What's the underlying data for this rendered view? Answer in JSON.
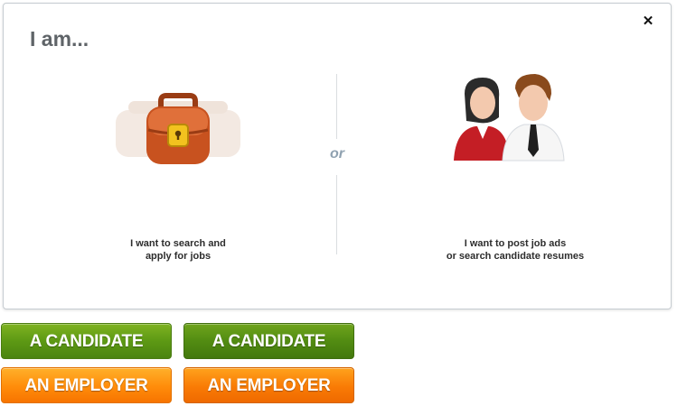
{
  "modal": {
    "title": "I am...",
    "close_icon": "close-icon",
    "separator": "or",
    "candidate": {
      "icon": "briefcase-icon",
      "desc_line1": "I want to search and",
      "desc_line2": "apply for jobs"
    },
    "employer": {
      "icon": "people-icon",
      "desc_line1": "I want to post job ads",
      "desc_line2": "or search candidate resumes"
    }
  },
  "buttons": {
    "candidate_label": "A CANDIDATE",
    "candidate_hover_label": "A CANDIDATE",
    "employer_label": "AN EMPLOYER",
    "employer_hover_label": "AN EMPLOYER"
  },
  "colors": {
    "green": "#5d9914",
    "orange": "#ff8c0a",
    "title": "#5f6468",
    "or": "#8fa1b0"
  }
}
